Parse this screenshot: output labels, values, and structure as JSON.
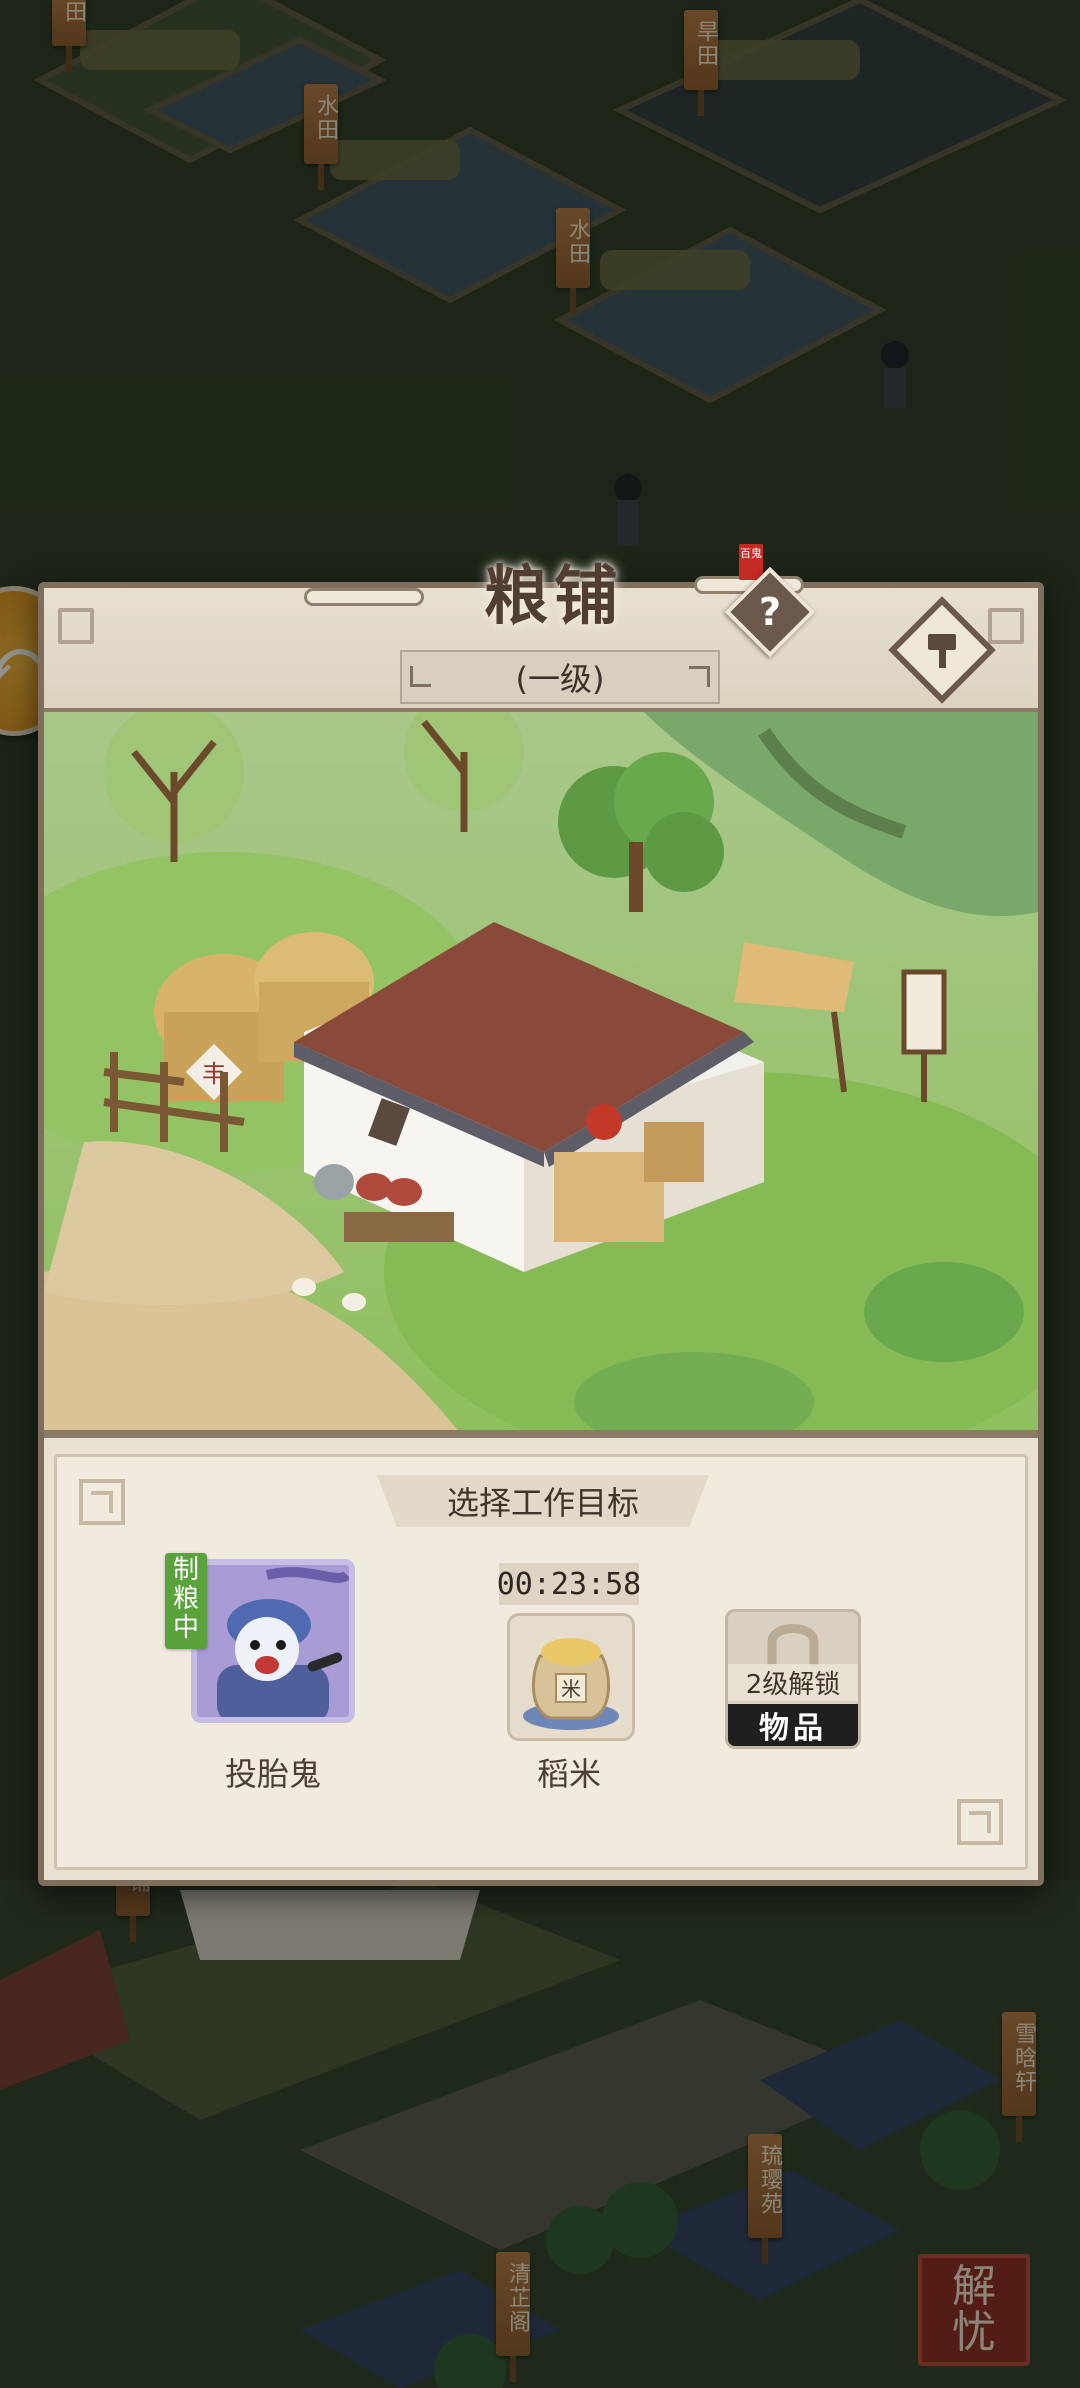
{
  "map": {
    "signs": [
      {
        "label": "田"
      },
      {
        "label": "旱田"
      },
      {
        "label": "水田"
      },
      {
        "label": "水田"
      },
      {
        "label": "铺"
      },
      {
        "label": "雪晗轩"
      },
      {
        "label": "琉璎苑"
      },
      {
        "label": "清芷阁"
      }
    ],
    "corner_seal_chars": [
      "解",
      "忧"
    ]
  },
  "panel": {
    "title": "粮铺",
    "title_seal": "百鬼",
    "level": "(一级)",
    "help_label": "?",
    "section_title": "选择工作目标",
    "worker": {
      "name": "投胎鬼",
      "status": "制粮中"
    },
    "production": {
      "timer": "00:23:58",
      "item_name": "稻米",
      "item_glyph": "米"
    },
    "locked_slot": {
      "requirement": "2级解锁",
      "label": "物品"
    }
  },
  "colors": {
    "panel_bg": "#e9e1d1",
    "panel_border": "#7f6e5c",
    "status_green": "#5aa23c",
    "seal_red": "#8e2a20"
  },
  "icons": {
    "help": "question-icon",
    "build": "hammer-icon",
    "lock": "lock-icon",
    "item": "rice-sack-icon"
  }
}
